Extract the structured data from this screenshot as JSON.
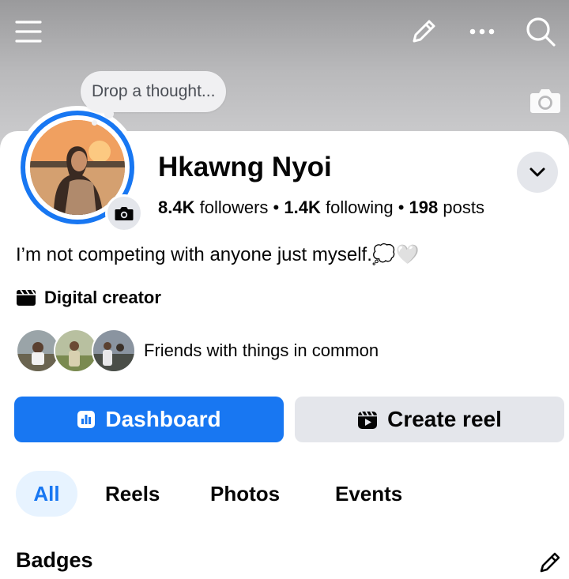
{
  "topbar": {
    "menu_icon": "hamburger-icon",
    "edit_icon": "pencil-icon",
    "more_icon": "more-dots-icon",
    "search_icon": "search-icon"
  },
  "note": {
    "placeholder": "Drop a thought..."
  },
  "profile": {
    "name": "Hkawng Nyoi",
    "followers_count": "8.4K",
    "followers_label": "followers",
    "following_count": "1.4K",
    "following_label": "following",
    "posts_count": "198",
    "posts_label": "posts",
    "separator": "•",
    "bio": "I’m not competing with anyone just myself.💭🤍",
    "category": "Digital creator",
    "mutual_friends_text": "Friends with things in common"
  },
  "buttons": {
    "dashboard": "Dashboard",
    "create_reel": "Create reel"
  },
  "tabs": [
    {
      "label": "All",
      "active": true
    },
    {
      "label": "Reels",
      "active": false
    },
    {
      "label": "Photos",
      "active": false
    },
    {
      "label": "Events",
      "active": false
    }
  ],
  "section": {
    "badges_title": "Badges"
  },
  "colors": {
    "accent": "#1877f2",
    "secondary_button": "#e4e6eb",
    "active_tab_bg": "#e7f3ff"
  }
}
